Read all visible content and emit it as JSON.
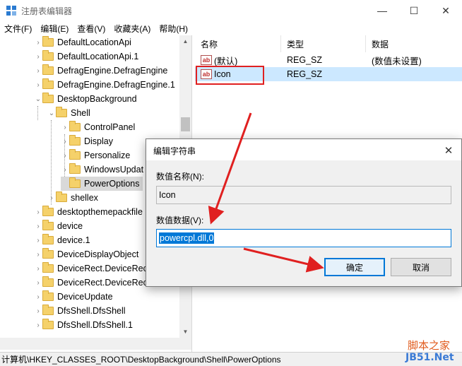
{
  "window": {
    "title": "注册表编辑器",
    "min_glyph": "—",
    "max_glyph": "☐",
    "close_glyph": "✕"
  },
  "menu": [
    "文件(F)",
    "编辑(E)",
    "查看(V)",
    "收藏夹(A)",
    "帮助(H)"
  ],
  "tree": {
    "items": [
      {
        "label": "DefaultLocationApi",
        "expander": "›",
        "level": 0
      },
      {
        "label": "DefaultLocationApi.1",
        "expander": "›",
        "level": 0
      },
      {
        "label": "DefragEngine.DefragEngine",
        "expander": "›",
        "level": 0
      },
      {
        "label": "DefragEngine.DefragEngine.1",
        "expander": "›",
        "level": 0
      },
      {
        "label": "DesktopBackground",
        "expander": "⌄",
        "level": 0
      },
      {
        "label": "Shell",
        "expander": "⌄",
        "level": 1
      },
      {
        "label": "ControlPanel",
        "expander": "›",
        "level": 2
      },
      {
        "label": "Display",
        "expander": "›",
        "level": 2
      },
      {
        "label": "Personalize",
        "expander": "›",
        "level": 2
      },
      {
        "label": "WindowsUpdat",
        "expander": "›",
        "level": 2
      },
      {
        "label": "PowerOptions",
        "expander": "",
        "level": 2,
        "selected": true
      },
      {
        "label": "shellex",
        "expander": "›",
        "level": 1
      },
      {
        "label": "desktopthemepackfile",
        "expander": "›",
        "level": 0
      },
      {
        "label": "device",
        "expander": "›",
        "level": 0
      },
      {
        "label": "device.1",
        "expander": "›",
        "level": 0
      },
      {
        "label": "DeviceDisplayObject",
        "expander": "›",
        "level": 0
      },
      {
        "label": "DeviceRect.DeviceRec",
        "expander": "›",
        "level": 0
      },
      {
        "label": "DeviceRect.DeviceRec",
        "expander": "›",
        "level": 0
      },
      {
        "label": "DeviceUpdate",
        "expander": "›",
        "level": 0
      },
      {
        "label": "DfsShell.DfsShell",
        "expander": "›",
        "level": 0
      },
      {
        "label": "DfsShell.DfsShell.1",
        "expander": "›",
        "level": 0
      }
    ],
    "scroll_up": "▲",
    "scroll_down": "▼"
  },
  "values": {
    "columns": [
      "名称",
      "类型",
      "数据"
    ],
    "rows": [
      {
        "name": "(默认)",
        "type": "REG_SZ",
        "data": "(数值未设置)",
        "icon": "ab"
      },
      {
        "name": "Icon",
        "type": "REG_SZ",
        "data": "",
        "icon": "ab",
        "selected": true
      }
    ]
  },
  "status": "计算机\\HKEY_CLASSES_ROOT\\DesktopBackground\\Shell\\PowerOptions",
  "dialog": {
    "title": "编辑字符串",
    "close_glyph": "✕",
    "name_label": "数值名称(N):",
    "name_value": "Icon",
    "data_label": "数值数据(V):",
    "data_value": "powercpl.dll,0",
    "ok_label": "确定",
    "cancel_label": "取消"
  },
  "watermark": {
    "cn": "脚本之家",
    "en": "JB51.Net"
  },
  "colors": {
    "selection": "#cce8ff",
    "accent": "#0078d7",
    "annotation_red": "#e02020"
  }
}
